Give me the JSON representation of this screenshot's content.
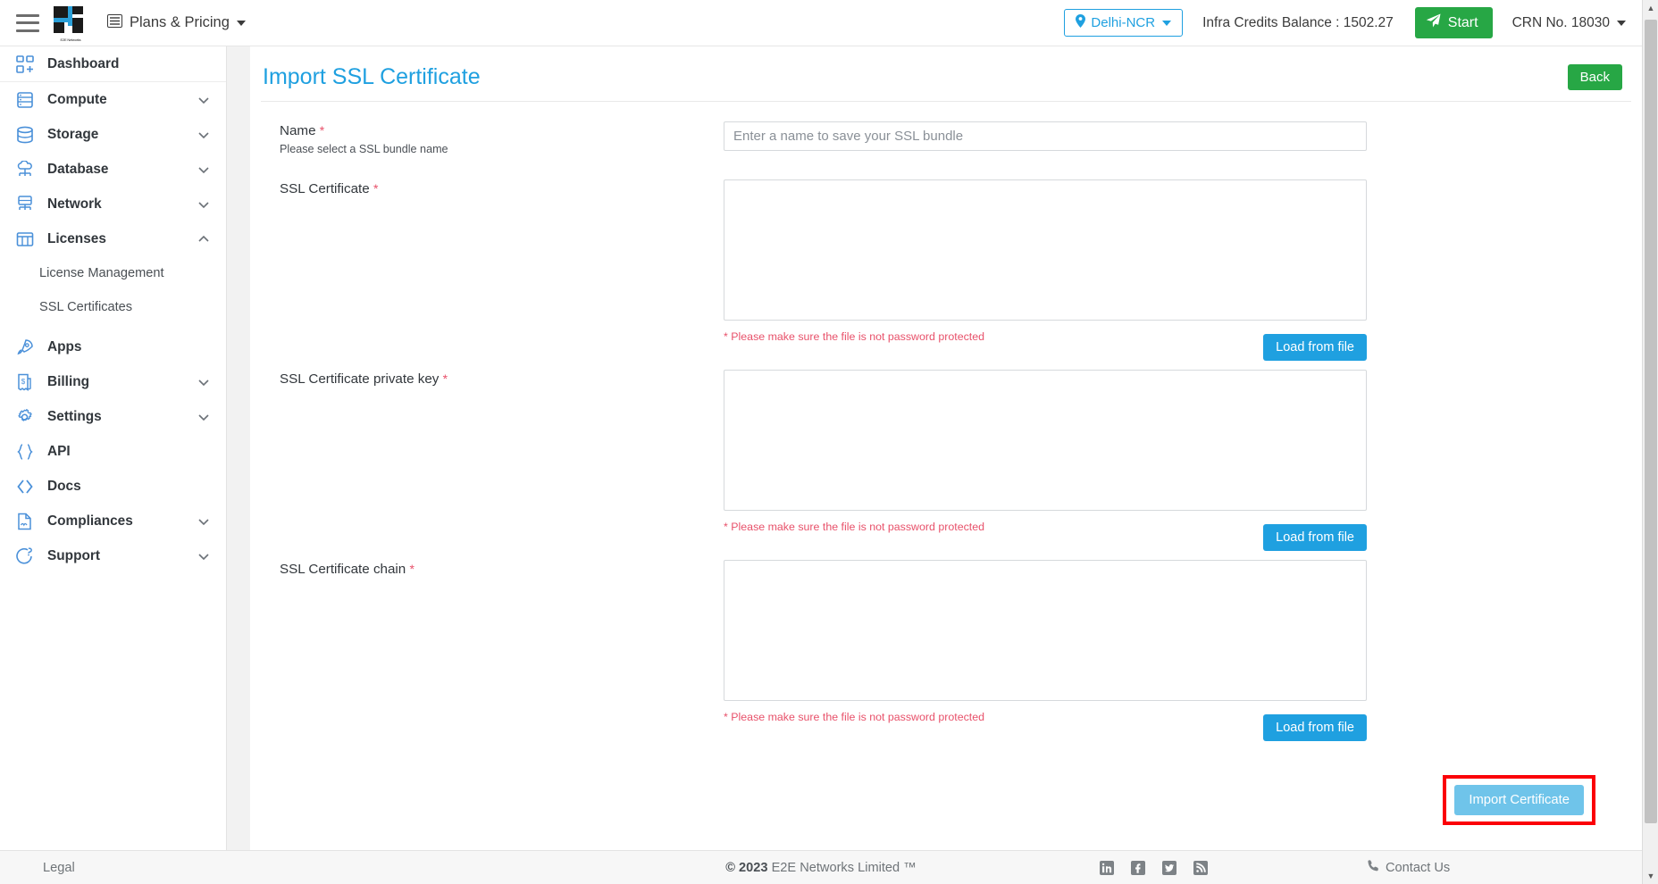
{
  "header": {
    "menu_icon": "hamburger-icon",
    "logo_caption": "E2E Networks",
    "plans_label": "Plans & Pricing",
    "plans_icon": "list-icon",
    "region_label": "Delhi-NCR",
    "region_icon": "map-pin-icon",
    "credits_label": "Infra Credits Balance : 1502.27",
    "start_label": "Start",
    "start_icon": "paper-plane-icon",
    "start_color": "#27a745",
    "crn_label": "CRN No. 18030"
  },
  "sidebar": {
    "items": [
      {
        "label": "Dashboard",
        "icon": "dashboard-grid-icon",
        "expandable": false
      },
      {
        "label": "Compute",
        "icon": "server-icon",
        "expandable": true,
        "expanded": false
      },
      {
        "label": "Storage",
        "icon": "database-stack-icon",
        "expandable": true,
        "expanded": false
      },
      {
        "label": "Database",
        "icon": "cloud-database-icon",
        "expandable": true,
        "expanded": false
      },
      {
        "label": "Network",
        "icon": "network-node-icon",
        "expandable": true,
        "expanded": false
      },
      {
        "label": "Licenses",
        "icon": "license-grid-icon",
        "expandable": true,
        "expanded": true
      },
      {
        "label": "Apps",
        "icon": "rocket-icon",
        "expandable": false
      },
      {
        "label": "Billing",
        "icon": "invoice-dollar-icon",
        "expandable": true,
        "expanded": false
      },
      {
        "label": "Settings",
        "icon": "gear-icon",
        "expandable": true,
        "expanded": false
      },
      {
        "label": "API",
        "icon": "braces-icon",
        "expandable": false
      },
      {
        "label": "Docs",
        "icon": "code-brackets-icon",
        "expandable": false
      },
      {
        "label": "Compliances",
        "icon": "document-icon",
        "expandable": true,
        "expanded": false
      },
      {
        "label": "Support",
        "icon": "support-question-icon",
        "expandable": true,
        "expanded": false
      }
    ],
    "licenses_subitems": [
      {
        "label": "License Management"
      },
      {
        "label": "SSL Certificates"
      }
    ]
  },
  "main": {
    "page_title": "Import SSL Certificate",
    "back_label": "Back",
    "accent_color": "#1fa0e0",
    "fields": {
      "name": {
        "label": "Name",
        "required_marker": "*",
        "sub_label": "Please select a SSL bundle name",
        "placeholder": "Enter a name to save your SSL bundle",
        "value": ""
      },
      "certificate": {
        "label": "SSL Certificate",
        "required_marker": "*",
        "value": "",
        "hint": "* Please make sure the file is not password protected",
        "load_label": "Load from file"
      },
      "private_key": {
        "label": "SSL Certificate private key",
        "required_marker": "*",
        "value": "",
        "hint": "* Please make sure the file is not password protected",
        "load_label": "Load from file"
      },
      "chain": {
        "label": "SSL Certificate chain",
        "required_marker": "*",
        "value": "",
        "hint": "* Please make sure the file is not password protected",
        "load_label": "Load from file"
      }
    },
    "submit": {
      "label": "Import Certificate",
      "button_color": "#6fc4ea",
      "highlight_color": "#fb0007"
    }
  },
  "footer": {
    "legal_label": "Legal",
    "copyright_symbol": "©",
    "copyright_year": "2023",
    "copyright_text": "E2E Networks Limited ™",
    "social": [
      {
        "name": "linkedin-icon",
        "glyph": "in"
      },
      {
        "name": "facebook-icon",
        "glyph": "f"
      },
      {
        "name": "twitter-icon",
        "glyph": "t"
      },
      {
        "name": "rss-icon",
        "glyph": "r"
      }
    ],
    "contact_label": "Contact Us",
    "contact_icon": "phone-icon"
  }
}
